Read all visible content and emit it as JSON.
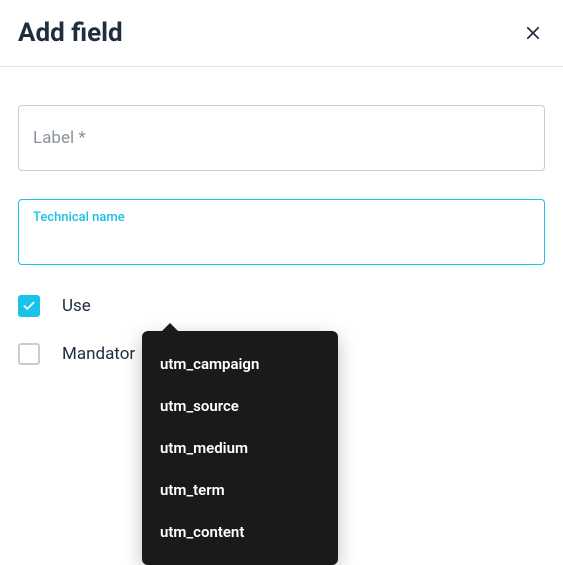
{
  "header": {
    "title": "Add field"
  },
  "fields": {
    "label": {
      "placeholder": "Label *",
      "value": ""
    },
    "technical_name": {
      "floating_label": "Technical name",
      "value": ""
    }
  },
  "checkboxes": {
    "use": {
      "label": "Use",
      "checked": true
    },
    "mandatory": {
      "label": "Mandator",
      "checked": false
    }
  },
  "dropdown": {
    "items": [
      "utm_campaign",
      "utm_source",
      "utm_medium",
      "utm_term",
      "utm_content"
    ]
  },
  "colors": {
    "accent": "#19c3e8",
    "text": "#1f2d3d",
    "muted": "#8a939c",
    "dropdown_bg": "#1a1a1a"
  }
}
